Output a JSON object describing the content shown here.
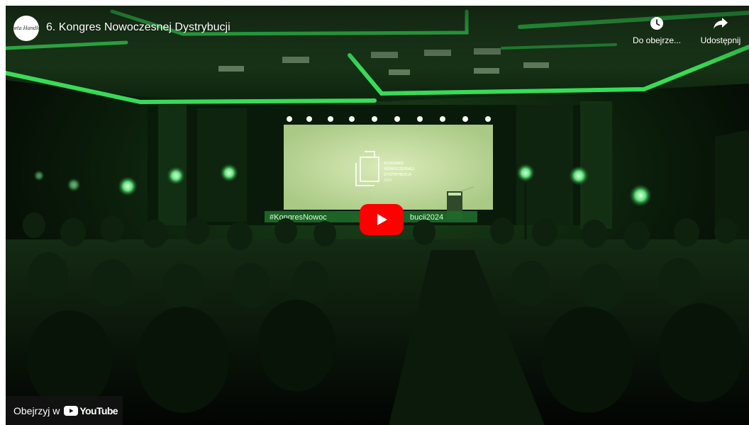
{
  "channel": {
    "avatar_text": "Gazeta Handlowa"
  },
  "video": {
    "title": "6. Kongres Nowoczesnej Dystrybucji"
  },
  "actions": {
    "watch_later_label": "Do obejrze...",
    "share_label": "Udostępnij"
  },
  "screen": {
    "logo_lines": [
      "KONGRES",
      "NOWOCZESNEJ",
      "DYSTRYBUCJI",
      "2024"
    ],
    "banner_left": "#KongresNowoc",
    "banner_right": "bucji2024"
  },
  "footer": {
    "watch_on_label": "Obejrzyj w",
    "youtube_label": "YouTube"
  },
  "icons": {
    "watch_later": "clock-icon",
    "share": "share-arrow-icon",
    "play": "play-icon",
    "youtube_logo": "youtube-logo-icon"
  },
  "colors": {
    "play_button": "#ff0000",
    "stage_glow": "#22e04a",
    "screen": "#cfe3a8"
  }
}
